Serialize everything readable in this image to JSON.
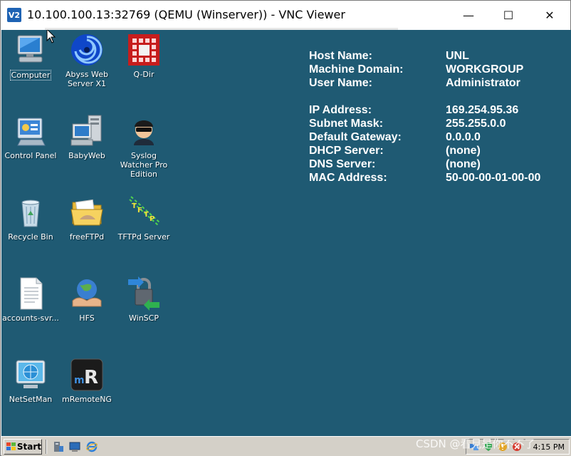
{
  "window": {
    "app_icon_text": "V2",
    "title": "10.100.100.13:32769 (QEMU (Winserver)) - VNC Viewer",
    "minimize_symbol": "—",
    "maximize_symbol": "☐",
    "close_symbol": "✕"
  },
  "desktop": {
    "background": "#1f5a73",
    "icons": [
      {
        "label": "Computer",
        "icon": "computer-icon"
      },
      {
        "label": "Abyss Web Server X1",
        "icon": "abyss-icon"
      },
      {
        "label": "Q-Dir",
        "icon": "qdir-icon"
      },
      {
        "label": "Control Panel",
        "icon": "control-panel-icon"
      },
      {
        "label": "BabyWeb",
        "icon": "babyweb-icon"
      },
      {
        "label": "Syslog Watcher Pro Edition",
        "icon": "syslog-icon"
      },
      {
        "label": "Recycle Bin",
        "icon": "recycle-bin-icon"
      },
      {
        "label": "freeFTPd",
        "icon": "folder-icon"
      },
      {
        "label": "TFTPd Server",
        "icon": "tftpd-icon"
      },
      {
        "label": "accounts-svr...",
        "icon": "text-file-icon"
      },
      {
        "label": "HFS",
        "icon": "hfs-icon"
      },
      {
        "label": "WinSCP",
        "icon": "winscp-icon"
      },
      {
        "label": "NetSetMan",
        "icon": "netsetman-icon"
      },
      {
        "label": "mRemoteNG",
        "icon": "mremoteng-icon"
      }
    ]
  },
  "bginfo": {
    "rows": [
      {
        "key": "Host Name:",
        "value": "UNL"
      },
      {
        "key": "Machine Domain:",
        "value": "WORKGROUP"
      },
      {
        "key": "User Name:",
        "value": "Administrator"
      },
      {
        "key": "IP Address:",
        "value": "169.254.95.36"
      },
      {
        "key": "Subnet Mask:",
        "value": "255.255.0.0"
      },
      {
        "key": "Default Gateway:",
        "value": "0.0.0.0"
      },
      {
        "key": "DHCP Server:",
        "value": "(none)"
      },
      {
        "key": "DNS Server:",
        "value": "(none)"
      },
      {
        "key": "MAC Address:",
        "value": "50-00-00-01-00-00"
      }
    ]
  },
  "taskbar": {
    "start_label": "Start",
    "clock": "4:15 PM"
  },
  "watermark": "CSDN @看見是你不不了"
}
